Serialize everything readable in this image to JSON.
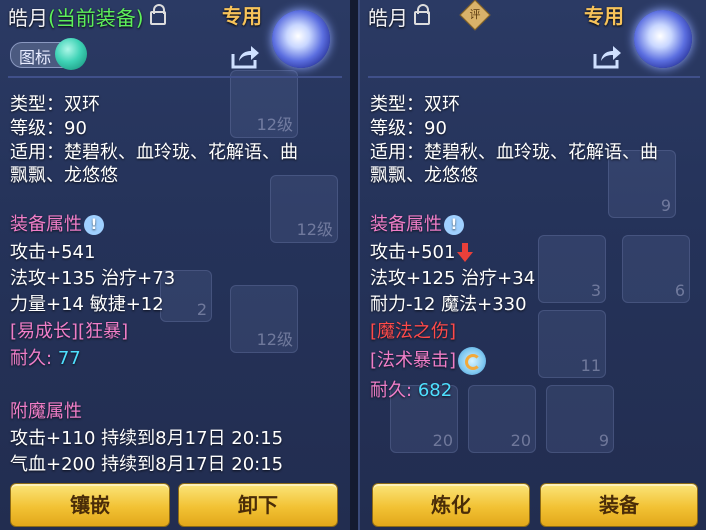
{
  "left": {
    "title_name": "皓月",
    "title_status": "(当前装备)",
    "tag": "专用",
    "icon_toggle_label": "图标",
    "type": "类型：双环",
    "level": "等级：90",
    "suitable_1": "适用：楚碧秋、血玲珑、花解语、曲",
    "suitable_2": "飘飘、龙悠悠",
    "attr_header": "装备属性",
    "attack": "攻击+541",
    "magic_line": "法攻+135 治疗+73",
    "str_line": "力量+14 敏捷+12",
    "specials": "[易成长][狂暴]",
    "durability_label": "耐久:",
    "durability_value": "77",
    "enchant_header": "附魔属性",
    "enchant_1": "攻击+110 持续到8月17日 20:15",
    "enchant_2": "气血+200 持续到8月17日 20:15",
    "btn_inlay": "镶嵌",
    "btn_unequip": "卸下"
  },
  "right": {
    "title_name": "皓月",
    "eval_badge": "评",
    "tag": "专用",
    "type": "类型：双环",
    "level": "等级：90",
    "suitable_1": "适用：楚碧秋、血玲珑、花解语、曲",
    "suitable_2": "飘飘、龙悠悠",
    "attr_header": "装备属性",
    "attack": "攻击+501",
    "magic_line": "法攻+125 治疗+34",
    "endure_line": "耐力-12 魔法+330",
    "special_1": "[魔法之伤]",
    "special_2": "[法术暴击]",
    "durability_label": "耐久:",
    "durability_value": "682",
    "btn_refine": "炼化",
    "btn_equip": "装备"
  },
  "background_slots": {
    "numbers": [
      "9",
      "3",
      "6",
      "11",
      "20",
      "20",
      "9",
      "12级",
      "12级",
      "12级",
      "2"
    ]
  },
  "colors": {
    "current_equip": "#5df05a",
    "section_pink": "#f07ec8",
    "durability_cyan": "#4fe0ff",
    "tag_gold": "#f7c35a",
    "button_gold": "#f2c234"
  }
}
